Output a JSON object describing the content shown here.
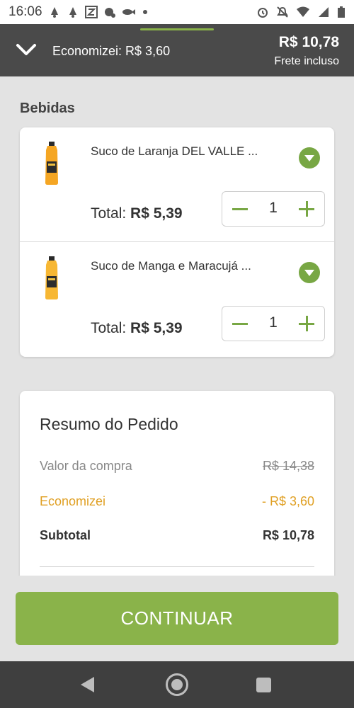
{
  "status_bar": {
    "time": "16:06",
    "left_icons": [
      "notification-icon",
      "notification-icon",
      "zap-icon",
      "notification-icon",
      "fish-icon",
      "dot-icon"
    ],
    "right_icons": [
      "alarm-icon",
      "mute-icon",
      "wifi-icon",
      "signal-icon",
      "battery-icon"
    ]
  },
  "header": {
    "saved_text": "Economizei: R$ 3,60",
    "total": "R$ 10,78",
    "shipping": "Frete incluso"
  },
  "section_title": "Bebidas",
  "cart": {
    "items": [
      {
        "name": "Suco de Laranja DEL VALLE ...",
        "total_prefix": "Total:",
        "total_value": "R$ 5,39",
        "quantity": "1"
      },
      {
        "name": "Suco de Manga e Maracujá ...",
        "total_prefix": "Total:",
        "total_value": "R$ 5,39",
        "quantity": "1"
      }
    ]
  },
  "summary": {
    "title": "Resumo do Pedido",
    "rows": [
      {
        "label": "Valor da compra",
        "value": "R$ 14,38"
      },
      {
        "label": "Economizei",
        "value": "- R$ 3,60"
      },
      {
        "label": "Subtotal",
        "value": "R$ 10,78"
      }
    ]
  },
  "continue_label": "CONTINUAR",
  "colors": {
    "accent_green": "#8ab34a",
    "discount_orange": "#e0a024",
    "header_bg": "#4a4a4a",
    "nav_bg": "#3f3f3f"
  }
}
